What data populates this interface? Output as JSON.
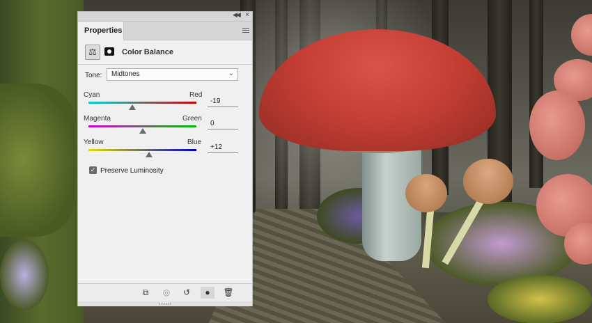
{
  "panel": {
    "tab_label": "Properties",
    "adjustment_title": "Color Balance",
    "icons": {
      "collapse": "double-chevron-left-icon",
      "close": "close-icon",
      "menu": "hamburger-menu-icon",
      "adjustment": "balance-scale-icon",
      "mask": "layer-mask-icon"
    }
  },
  "tone": {
    "label": "Tone:",
    "selected": "Midtones"
  },
  "sliders": [
    {
      "left": "Cyan",
      "right": "Red",
      "value": "-19",
      "level": -19
    },
    {
      "left": "Magenta",
      "right": "Green",
      "value": "0",
      "level": 0
    },
    {
      "left": "Yellow",
      "right": "Blue",
      "value": "+12",
      "level": 12
    }
  ],
  "preserve_luminosity": {
    "label": "Preserve Luminosity",
    "checked": true
  },
  "bottom_toolbar": [
    {
      "name": "clip-to-layer-icon",
      "glyph": "⧉"
    },
    {
      "name": "view-previous-state-icon",
      "glyph": "◎"
    },
    {
      "name": "reset-icon",
      "glyph": "↺"
    },
    {
      "name": "toggle-visibility-icon",
      "glyph": "👁"
    },
    {
      "name": "delete-icon",
      "glyph": "🗑"
    }
  ],
  "colors": {
    "cyan_red": [
      "#00d4d4",
      "#d40000"
    ],
    "magenta_green": [
      "#d400d4",
      "#00c000"
    ],
    "yellow_blue": [
      "#e0e000",
      "#0000c8"
    ]
  }
}
